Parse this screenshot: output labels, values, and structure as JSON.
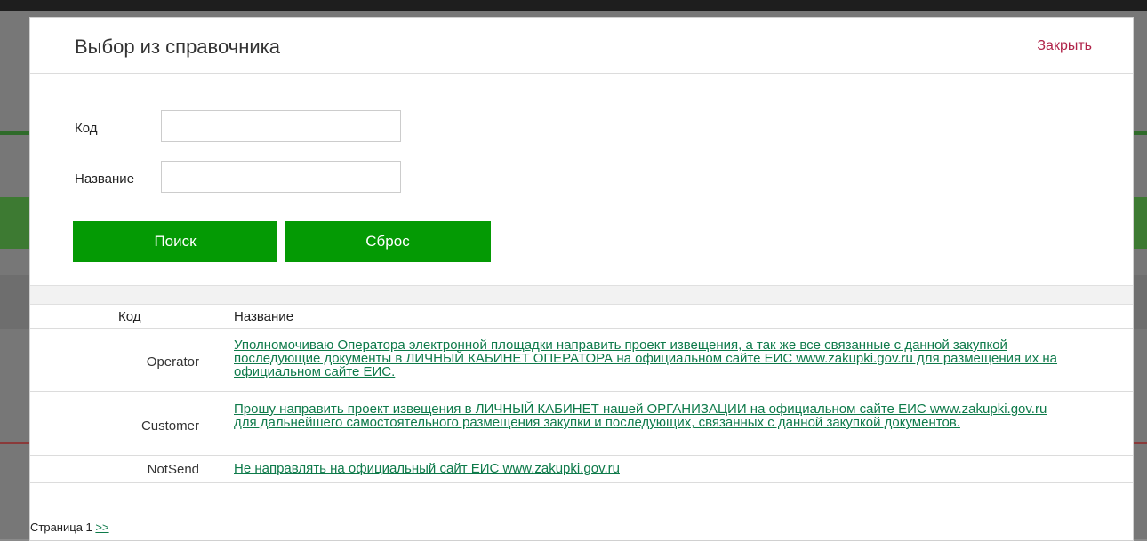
{
  "modal": {
    "title": "Выбор из справочника",
    "close_label": "Закрыть"
  },
  "form": {
    "code_label": "Код",
    "code_value": "",
    "name_label": "Название",
    "name_value": "",
    "search_label": "Поиск",
    "reset_label": "Сброс"
  },
  "table": {
    "headers": [
      "Код",
      "Название"
    ],
    "rows": [
      {
        "code": "Operator",
        "name": "Уполномочиваю Оператора электронной площадки направить проект извещения, а так же все связанные с данной закупкой последующие документы в ЛИЧНЫЙ КАБИНЕТ ОПЕРАТОРА на официальном сайте ЕИС www.zakupki.gov.ru для размещения их на официальном сайте ЕИС."
      },
      {
        "code": "Customer",
        "name": "Прошу направить проект извещения в ЛИЧНЫЙ КАБИНЕТ нашей ОРГАНИЗАЦИИ на официальном сайте ЕИС www.zakupki.gov.ru для дальнейшего самостоятельного размещения закупки и последующих, связанных с данной закупкой документов."
      },
      {
        "code": "NotSend",
        "name": "Не направлять на официальный сайт ЕИС www.zakupki.gov.ru"
      }
    ]
  },
  "pager": {
    "page_text": "Страница 1",
    "next_label": ">>"
  },
  "colors": {
    "accent_green": "#049a04",
    "link_green": "#0e7a4a",
    "close_red": "#b0244a"
  }
}
